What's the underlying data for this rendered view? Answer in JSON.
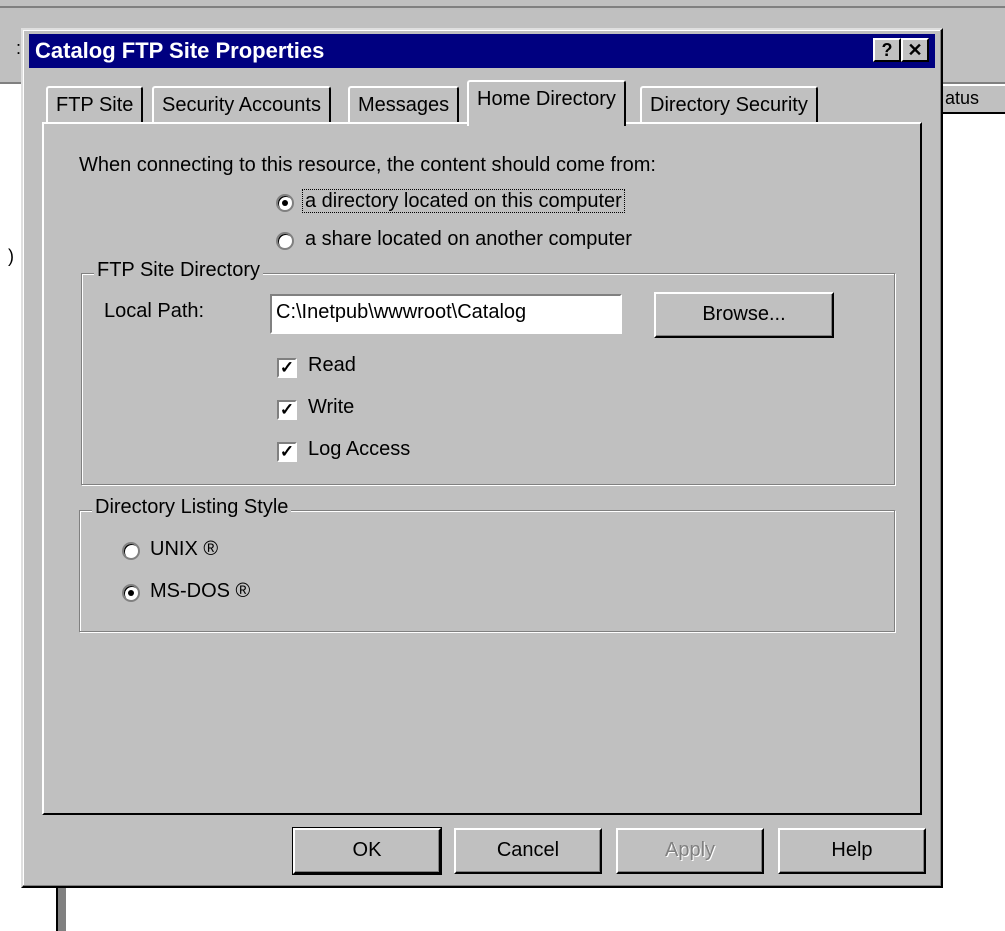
{
  "background": {
    "left_fragment": ":",
    "header_fragment": "atus",
    "side_fragment": ")"
  },
  "dialog": {
    "title": "Catalog FTP Site Properties",
    "help_button": "?",
    "close_button": "✕"
  },
  "tabs": [
    {
      "label": "FTP Site",
      "active": false
    },
    {
      "label": "Security Accounts",
      "active": false
    },
    {
      "label": "Messages",
      "active": false
    },
    {
      "label": "Home Directory",
      "active": true
    },
    {
      "label": "Directory Security",
      "active": false
    }
  ],
  "home_directory": {
    "prompt": "When connecting to this resource, the content should come from:",
    "source_options": [
      {
        "label": "a directory located on this computer",
        "selected": true
      },
      {
        "label": "a share located on another computer",
        "selected": false
      }
    ],
    "ftp_site_directory": {
      "group_title": "FTP Site Directory",
      "local_path_label": "Local Path:",
      "local_path_value": "C:\\Inetpub\\wwwroot\\Catalog",
      "browse_button": "Browse...",
      "permissions": [
        {
          "label": "Read",
          "checked": true
        },
        {
          "label": "Write",
          "checked": true
        },
        {
          "label": "Log Access",
          "checked": true
        }
      ]
    },
    "listing_style": {
      "group_title": "Directory Listing Style",
      "options": [
        {
          "label": "UNIX ®",
          "selected": false
        },
        {
          "label": "MS-DOS ®",
          "selected": true
        }
      ]
    }
  },
  "buttons": {
    "ok": "OK",
    "cancel": "Cancel",
    "apply": "Apply",
    "help": "Help"
  }
}
